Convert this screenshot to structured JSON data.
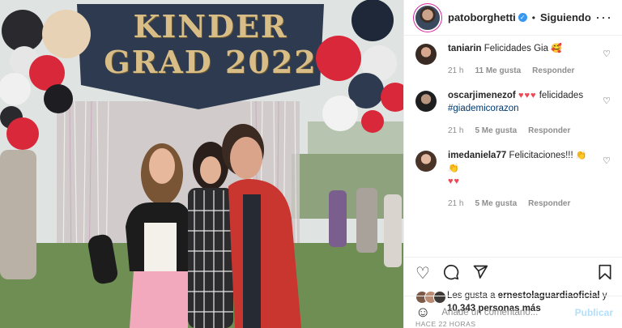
{
  "photo": {
    "banner_line1": "KINDER",
    "banner_line2": "GRAD 2022"
  },
  "header": {
    "username": "patoborghetti",
    "verified_glyph": "✓",
    "dot": "•",
    "follow_label": "Siguiendo",
    "more_glyph": "···",
    "avatar_icon": "profile-avatar"
  },
  "comments": [
    {
      "user": "taniarin",
      "text": "Felicidades Gia",
      "emoji": "🥰",
      "time": "21 h",
      "likes": "11 Me gusta",
      "reply": "Responder"
    },
    {
      "user": "oscarjimenezof",
      "hearts": "♥♥♥",
      "text": "felicidades",
      "hashtag": "#giademicorazon",
      "time": "21 h",
      "likes": "5 Me gusta",
      "reply": "Responder"
    },
    {
      "user": "imedaniela77",
      "text": "Felicitaciones!!!",
      "emoji": "👏👏",
      "hearts": "♥♥",
      "time": "21 h",
      "likes": "5 Me gusta",
      "reply": "Responder"
    }
  ],
  "actions": {
    "like_icon": "heart-icon",
    "comment_icon": "comment-icon",
    "share_icon": "share-icon",
    "save_icon": "bookmark-icon"
  },
  "likes": {
    "prefix": "Les gusta a",
    "user": "ernestolaguardiaoficial",
    "connector": "y",
    "count": "10,343 personas más"
  },
  "time_ago": "HACE 22 HORAS",
  "add_comment": {
    "placeholder": "Añade un comentario...",
    "publish_label": "Publicar"
  },
  "colors": {
    "verified": "#3897f0",
    "link": "#00376b",
    "muted": "#8e8e8e",
    "publish_disabled": "#b2dffc",
    "heart": "#ed4956"
  }
}
